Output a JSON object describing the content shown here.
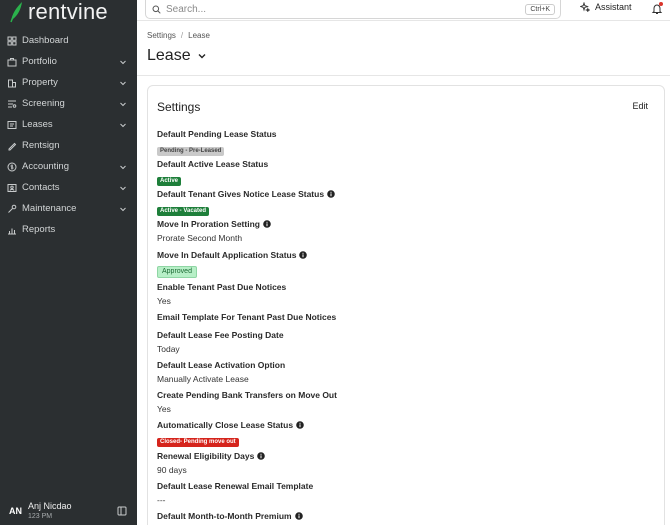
{
  "brand": {
    "name": "rentvine"
  },
  "sidebar": {
    "items": [
      {
        "label": "Dashboard",
        "icon": "dashboard-icon",
        "expandable": false
      },
      {
        "label": "Portfolio",
        "icon": "portfolio-icon",
        "expandable": true
      },
      {
        "label": "Property",
        "icon": "property-icon",
        "expandable": true
      },
      {
        "label": "Screening",
        "icon": "screening-icon",
        "expandable": true
      },
      {
        "label": "Leases",
        "icon": "leases-icon",
        "expandable": true
      },
      {
        "label": "Rentsign",
        "icon": "rentsign-icon",
        "expandable": false
      },
      {
        "label": "Accounting",
        "icon": "accounting-icon",
        "expandable": true
      },
      {
        "label": "Contacts",
        "icon": "contacts-icon",
        "expandable": true
      },
      {
        "label": "Maintenance",
        "icon": "maintenance-icon",
        "expandable": true
      },
      {
        "label": "Reports",
        "icon": "reports-icon",
        "expandable": false
      }
    ],
    "user": {
      "initials": "AN",
      "name": "Anj Nicdao",
      "time": "123 PM"
    }
  },
  "topbar": {
    "search_placeholder": "Search...",
    "shortcut": "Ctrl+K",
    "assistant_label": "Assistant"
  },
  "header": {
    "breadcrumb": [
      "Settings",
      "Lease"
    ],
    "title": "Lease"
  },
  "card": {
    "title": "Settings",
    "edit_label": "Edit",
    "settings": [
      {
        "label": "Default Pending Lease Status",
        "info": false,
        "kind": "badge",
        "badge_style": "gray",
        "value": "Pending - Pre-Leased"
      },
      {
        "label": "Default Active Lease Status",
        "info": false,
        "kind": "badge",
        "badge_style": "green",
        "value": "Active"
      },
      {
        "label": "Default Tenant Gives Notice Lease Status",
        "info": true,
        "kind": "badge",
        "badge_style": "green",
        "value": "Active - Vacated"
      },
      {
        "label": "Move In Proration Setting",
        "info": true,
        "kind": "text",
        "value": "Prorate Second Month"
      },
      {
        "label": "Move In Default Application Status",
        "info": true,
        "kind": "badge",
        "badge_style": "light",
        "value": "Approved"
      },
      {
        "label": "Enable Tenant Past Due Notices",
        "info": false,
        "kind": "text",
        "value": "Yes"
      },
      {
        "label": "Email Template For Tenant Past Due Notices",
        "info": false,
        "kind": "text",
        "value": ""
      },
      {
        "label": "Default Lease Fee Posting Date",
        "info": false,
        "kind": "text",
        "value": "Today"
      },
      {
        "label": "Default Lease Activation Option",
        "info": false,
        "kind": "text",
        "value": "Manually Activate Lease"
      },
      {
        "label": "Create Pending Bank Transfers on Move Out",
        "info": false,
        "kind": "text",
        "value": "Yes"
      },
      {
        "label": "Automatically Close Lease Status",
        "info": true,
        "kind": "badge",
        "badge_style": "red",
        "value": "Closed- Pending move out"
      },
      {
        "label": "Renewal Eligibility Days",
        "info": true,
        "kind": "text",
        "value": "90 days"
      },
      {
        "label": "Default Lease Renewal Email Template",
        "info": false,
        "kind": "text",
        "value": "---"
      },
      {
        "label": "Default Month-to-Month Premium",
        "info": true,
        "kind": "text",
        "value": ""
      }
    ]
  },
  "colors": {
    "sidebar_bg": "#2b2f31",
    "brand_green": "#2bb24c",
    "badge_green": "#1e7f3a",
    "badge_red": "#d5241c",
    "badge_gray": "#c9c9c9",
    "badge_light_green": "#b7efc7",
    "notification_dot": "#d9342b"
  }
}
